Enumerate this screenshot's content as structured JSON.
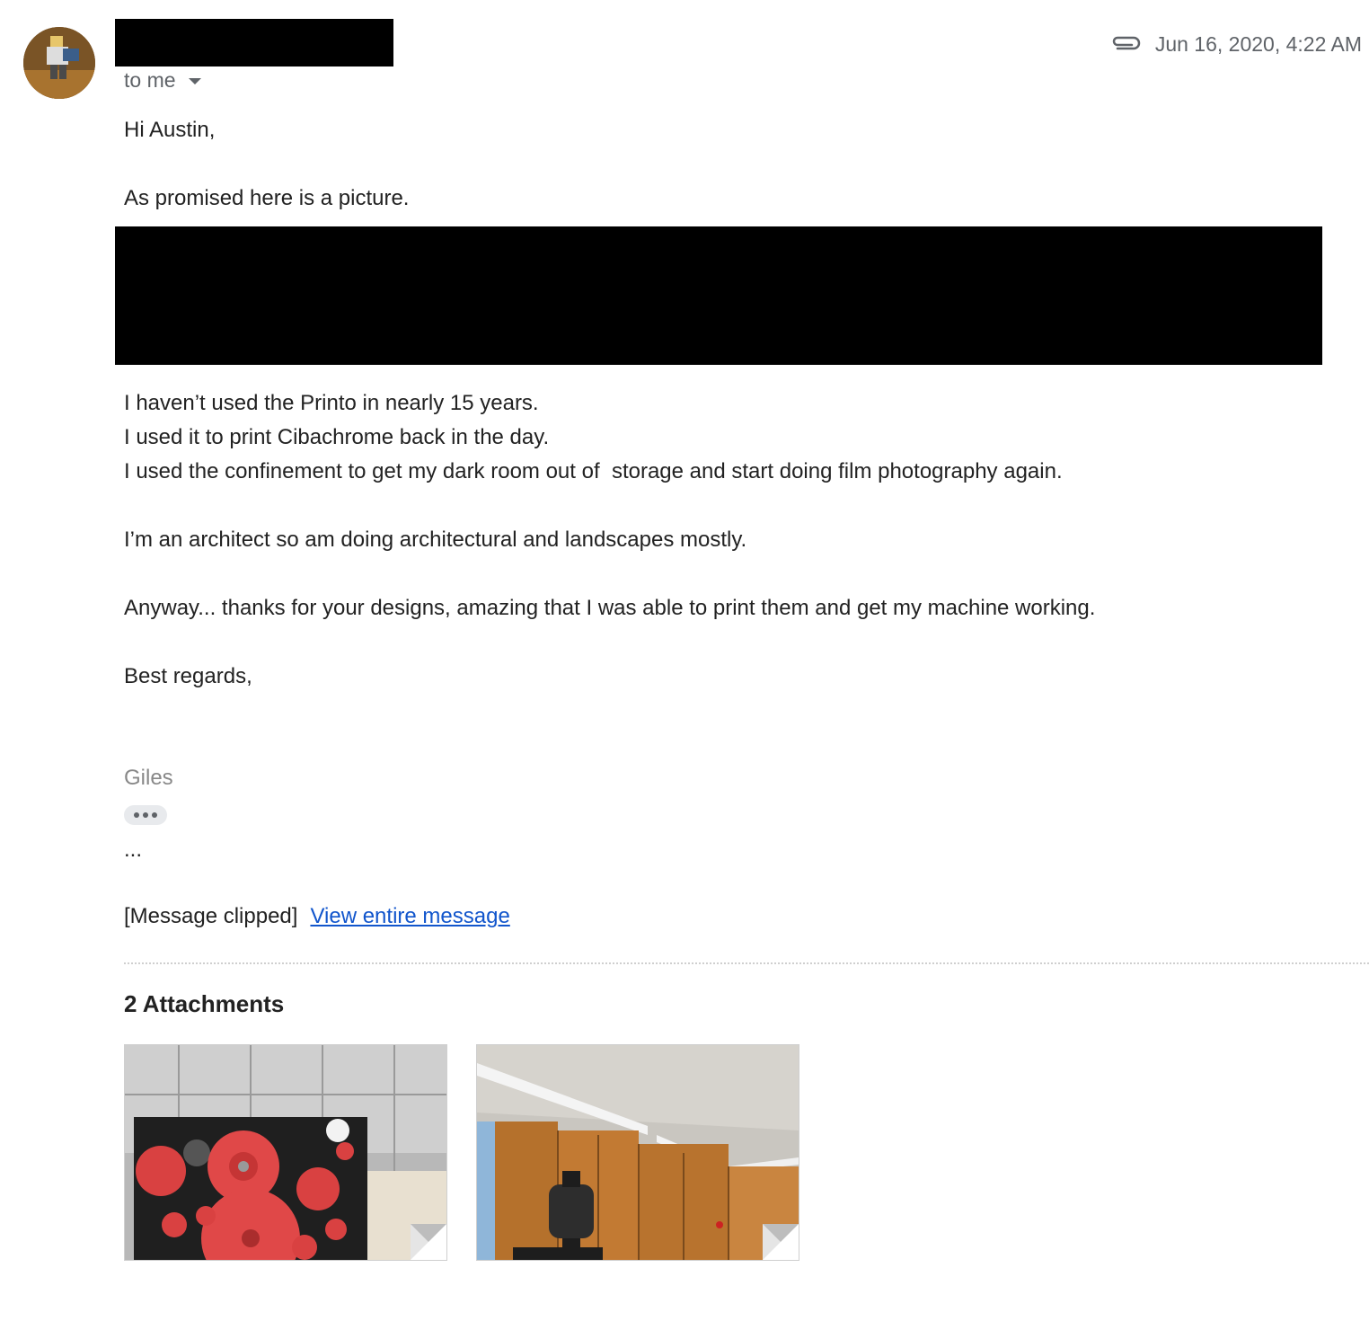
{
  "header": {
    "to_label": "to me",
    "date": "Jun 16, 2020, 4:22 AM",
    "attachment_icon": "paperclip-icon",
    "avatar_icon": "avatar"
  },
  "body": {
    "greeting": "Hi Austin,",
    "line_promised": "As promised here is a picture.",
    "line_1": "I haven’t used the Printo in nearly 15 years.",
    "line_2": "I used it to print Cibachrome back in the day.",
    "line_3": "I used the confinement to get my dark room out of  storage and start doing film photography again.",
    "line_architect": "I’m an architect so am doing architectural and landscapes mostly.",
    "line_anyway": "Anyway... thanks for your designs, amazing that I was able to print them and get my machine working.",
    "closing": "Best regards,",
    "signature": "Giles",
    "ellipsis": "..."
  },
  "clipped": {
    "text": "[Message clipped]",
    "link": "View entire message"
  },
  "attachments": {
    "title": "2 Attachments",
    "items": [
      {
        "name": "attachment-thumbnail-gears"
      },
      {
        "name": "attachment-thumbnail-darkroom"
      }
    ]
  }
}
